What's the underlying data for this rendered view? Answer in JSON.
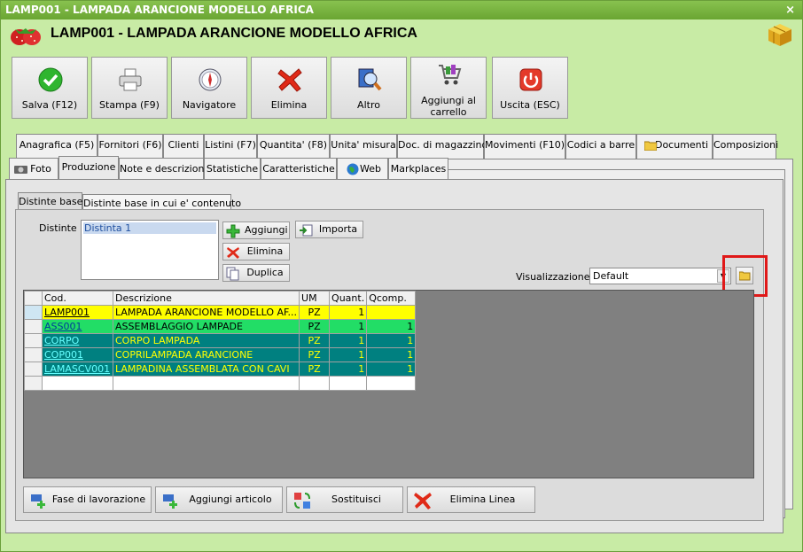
{
  "window": {
    "titlebar": "LAMP001 - LAMPADA ARANCIONE MODELLO AFRICA",
    "close_glyph": "×",
    "header_title": "LAMP001 - LAMPADA ARANCIONE MODELLO AFRICA"
  },
  "toolbar": {
    "buttons": [
      {
        "label": "Salva (F12)",
        "icon": "check-icon"
      },
      {
        "label": "Stampa (F9)",
        "icon": "printer-icon"
      },
      {
        "label": "Navigatore",
        "icon": "compass-icon"
      },
      {
        "label": "Elimina",
        "icon": "x-icon"
      },
      {
        "label": "Altro",
        "icon": "magnifier-icon"
      },
      {
        "label": "Aggiungi al carrello",
        "icon": "cart-icon"
      },
      {
        "label": "Uscita (ESC)",
        "icon": "power-icon"
      }
    ]
  },
  "tabs_row1": [
    "Anagrafica (F5)",
    "Fornitori (F6)",
    "Clienti",
    "Listini (F7)",
    "Quantita' (F8)",
    "Unita' misura",
    "Doc. di magazzino",
    "Movimenti (F10)",
    "Codici a barre",
    "Documenti",
    "Composizioni"
  ],
  "tabs_row2": [
    "Foto",
    "Produzione",
    "Note e descrizioni",
    "Statistiche",
    "Caratteristiche",
    "Web",
    "Markplaces"
  ],
  "active_tab_row2": "Produzione",
  "subtabs": [
    "Distinte base",
    "Distinte base in cui e' contenuto"
  ],
  "distinte": {
    "label": "Distinte :",
    "items": [
      "Distinta 1"
    ],
    "buttons": {
      "add": "Aggiungi",
      "delete": "Elimina",
      "duplicate": "Duplica",
      "import": "Importa"
    }
  },
  "visualizzazione": {
    "label": "Visualizzazione :",
    "value": "Default"
  },
  "grid": {
    "columns": [
      "Cod.",
      "Descrizione",
      "UM",
      "Quant.",
      "Qcomp."
    ],
    "rows": [
      {
        "cod": "LAMP001",
        "desc": "LAMPADA ARANCIONE MODELLO AF...",
        "um": "PZ",
        "quant": "1",
        "qcomp": "",
        "style": "r-yellow"
      },
      {
        "cod": "ASS001",
        "desc": "ASSEMBLAGGIO LAMPADE",
        "um": "PZ",
        "quant": "1",
        "qcomp": "1",
        "style": "r-green"
      },
      {
        "cod": "CORPO",
        "desc": "CORPO LAMPADA",
        "um": "PZ",
        "quant": "1",
        "qcomp": "1",
        "style": "r-teal"
      },
      {
        "cod": "COP001",
        "desc": "COPRILAMPADA ARANCIONE",
        "um": "PZ",
        "quant": "1",
        "qcomp": "1",
        "style": "r-teal"
      },
      {
        "cod": "LAMASCV001",
        "desc": "LAMPADINA ASSEMBLATA CON CAVI",
        "um": "PZ",
        "quant": "1",
        "qcomp": "1",
        "style": "r-teal"
      }
    ]
  },
  "bottom_buttons": [
    "Fase di lavorazione",
    "Aggiungi articolo",
    "Sostituisci",
    "Elimina Linea"
  ],
  "colors": {
    "window_bg": "#c8eba5",
    "titlebar": "#6aa532",
    "row_yellow": "#ffff00",
    "row_green": "#22dd66",
    "row_teal": "#008080",
    "highlight_box": "#e01818"
  }
}
